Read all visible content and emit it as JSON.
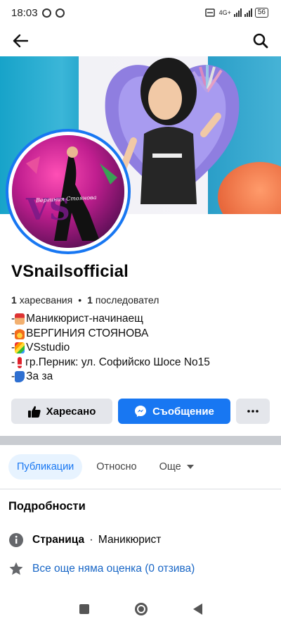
{
  "status_bar": {
    "time": "18:03",
    "network": "4G+",
    "battery": "56"
  },
  "nav": {
    "back_icon": "arrow-left-icon",
    "search_icon": "search-icon"
  },
  "profile": {
    "name": "VSnailsofficial",
    "likes_count": "1",
    "likes_label": "харесвания",
    "separator": "•",
    "followers_count": "1",
    "followers_label": "последовател",
    "avatar_caption": "Вергиния Стоянова"
  },
  "bio": [
    {
      "prefix": "-",
      "icon": "nail-polish-icon",
      "text": "Маникюрист-начинаещ"
    },
    {
      "prefix": "-",
      "icon": "fire-icon",
      "text": "ВЕРГИНИЯ СТОЯНОВА"
    },
    {
      "prefix": "-",
      "icon": "rainbow-icon",
      "text": "VSstudio"
    },
    {
      "prefix": "-",
      "icon": "exclamation-icon",
      "text": "гр.Перник: ул. Софийско Шосе No15"
    },
    {
      "prefix": "-",
      "icon": "phone-icon",
      "text": "За за"
    }
  ],
  "actions": {
    "like_label": "Харесано",
    "message_label": "Съобщение",
    "more_icon": "more-dots-icon"
  },
  "tabs": [
    {
      "label": "Публикации",
      "active": true
    },
    {
      "label": "Относно",
      "active": false
    },
    {
      "label": "Още",
      "active": false
    }
  ],
  "details": {
    "title": "Подробности",
    "category_label": "Страница",
    "category_separator": "·",
    "category_value": "Маникюрист",
    "rating_text": "Все още няма оценка (0 отзива)"
  },
  "colors": {
    "accent": "#1877f2",
    "button_gray": "#e4e6eb",
    "tab_active_bg": "#e7f3ff"
  }
}
